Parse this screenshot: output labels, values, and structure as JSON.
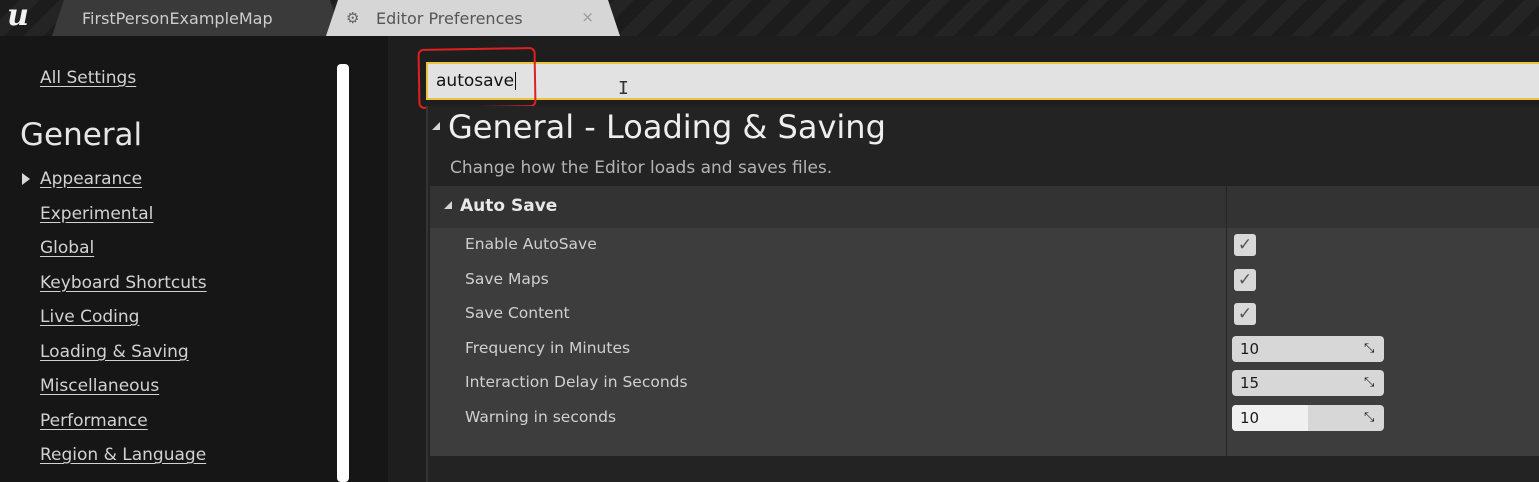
{
  "tabs": [
    {
      "label": "FirstPersonExampleMap"
    },
    {
      "label": "Editor Preferences",
      "close": "×"
    }
  ],
  "sidebar": {
    "all_settings": "All Settings",
    "heading": "General",
    "items": [
      {
        "label": "Appearance"
      },
      {
        "label": "Experimental"
      },
      {
        "label": "Global"
      },
      {
        "label": "Keyboard Shortcuts"
      },
      {
        "label": "Live Coding"
      },
      {
        "label": "Loading & Saving"
      },
      {
        "label": "Miscellaneous"
      },
      {
        "label": "Performance"
      },
      {
        "label": "Region & Language"
      }
    ]
  },
  "search": {
    "value": "autosave"
  },
  "section": {
    "title": "General - Loading & Saving",
    "description": "Change how the Editor loads and saves files."
  },
  "category": {
    "label": "Auto Save"
  },
  "settings": [
    {
      "label": "Enable AutoSave",
      "type": "checkbox",
      "checked": true
    },
    {
      "label": "Save Maps",
      "type": "checkbox",
      "checked": true
    },
    {
      "label": "Save Content",
      "type": "checkbox",
      "checked": true
    },
    {
      "label": "Frequency in Minutes",
      "type": "number",
      "value": "10"
    },
    {
      "label": "Interaction Delay in Seconds",
      "type": "number",
      "value": "15"
    },
    {
      "label": "Warning in seconds",
      "type": "number",
      "value": "10",
      "slider_fraction": 0.5
    }
  ],
  "icons": {
    "logo": "unreal-logo",
    "prefs_tab": "gear-icon",
    "checkmark": "✓"
  },
  "colors": {
    "search_highlight": "#e9c43f",
    "annotation": "#e02020"
  }
}
